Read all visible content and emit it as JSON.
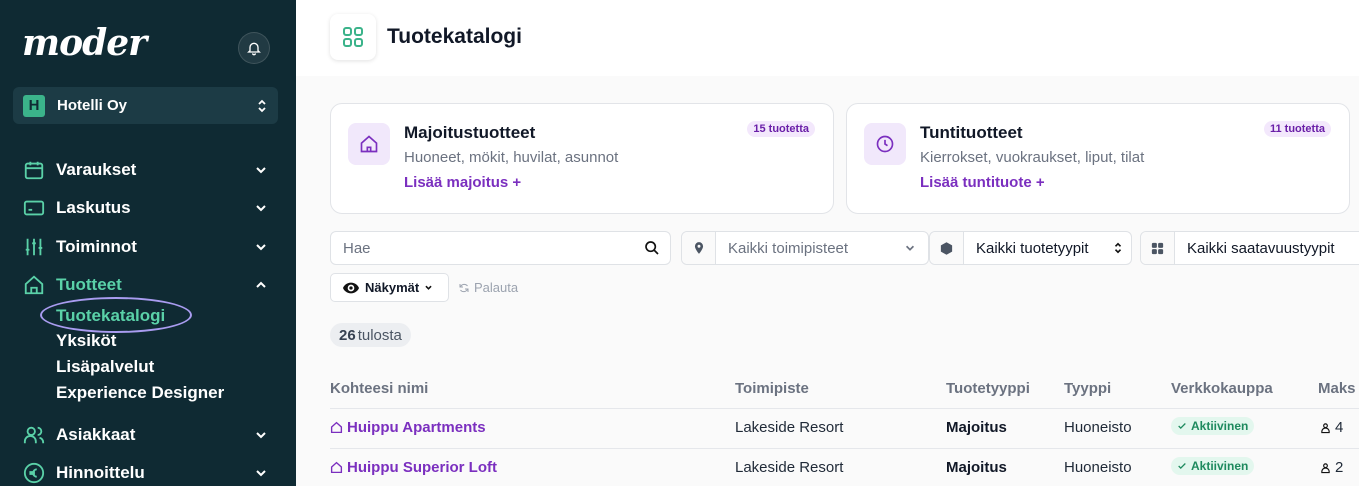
{
  "app": {
    "logo": "moder",
    "organization": {
      "badge": "H",
      "name": "Hotelli Oy"
    }
  },
  "sidebar": {
    "items": [
      {
        "label": "Varaukset",
        "icon": "calendar-icon"
      },
      {
        "label": "Laskutus",
        "icon": "credit-card-icon"
      },
      {
        "label": "Toiminnot",
        "icon": "sliders-icon"
      },
      {
        "label": "Tuotteet",
        "icon": "home-icon",
        "active": true
      },
      {
        "label": "Asiakkaat",
        "icon": "users-icon"
      },
      {
        "label": "Hinnoittelu",
        "icon": "euro-icon"
      }
    ],
    "subitems": [
      {
        "label": "Tuotekatalogi",
        "active": true
      },
      {
        "label": "Yksiköt"
      },
      {
        "label": "Lisäpalvelut"
      },
      {
        "label": "Experience Designer"
      }
    ]
  },
  "header": {
    "title": "Tuotekatalogi"
  },
  "cards": [
    {
      "title": "Majoitustuotteet",
      "description": "Huoneet, mökit, huvilat, asunnot",
      "link": "Lisää majoitus +",
      "badge": "15 tuotetta",
      "icon": "home-icon"
    },
    {
      "title": "Tuntituotteet",
      "description": "Kierrokset, vuokraukset, liput, tilat",
      "link": "Lisää tuntituote +",
      "badge": "11 tuotetta",
      "icon": "clock-icon"
    }
  ],
  "filters": {
    "search_placeholder": "Hae",
    "location": "Kaikki toimipisteet",
    "product_type": "Kaikki tuotetyypit",
    "availability": "Kaikki saatavuustyypit",
    "views_label": "Näkymät",
    "reset_label": "Palauta"
  },
  "results": {
    "count": "26",
    "label": "tulosta"
  },
  "table": {
    "columns": [
      "Kohteesi nimi",
      "Toimipiste",
      "Tuotetyyppi",
      "Tyyppi",
      "Verkkokauppa",
      "Maks"
    ],
    "rows": [
      {
        "name": "Huippu Apartments",
        "location": "Lakeside Resort",
        "product_type": "Majoitus",
        "type": "Huoneisto",
        "status": "Aktiivinen",
        "capacity": "4"
      },
      {
        "name": "Huippu Superior Loft",
        "location": "Lakeside Resort",
        "product_type": "Majoitus",
        "type": "Huoneisto",
        "status": "Aktiivinen",
        "capacity": "2"
      }
    ]
  },
  "colors": {
    "sidebar_bg": "#0f2a33",
    "accent_green": "#5ad1a8",
    "accent_purple": "#7b2fbf",
    "status_green": "#1e8a5e"
  }
}
